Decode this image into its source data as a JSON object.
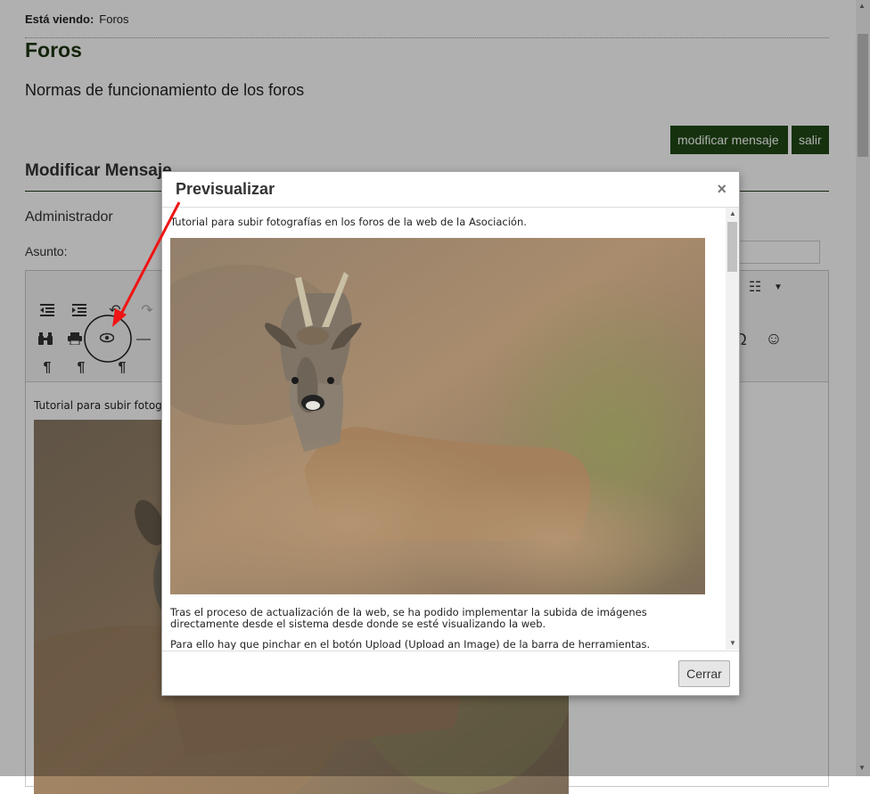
{
  "breadcrumb": {
    "label": "Está viendo:",
    "current": "Foros"
  },
  "page": {
    "title": "Foros",
    "forum_description": "Normas de funcionamiento de los foros",
    "buttons": {
      "modify": "modificar mensaje",
      "exit": "salir"
    },
    "section_title": "Modificar Mensaje",
    "author": "Administrador",
    "subject_label": "Asunto:"
  },
  "editor": {
    "text": "Tutorial para subir fotografías en los foros de la web de la Asociación.",
    "toolbar_icons": [
      "outdent-icon",
      "indent-icon",
      "undo-icon",
      "redo-icon",
      "find-icon",
      "print-icon",
      "preview-icon",
      "horizontal-rule-icon",
      "ltr-icon",
      "rtl-icon",
      "paragraph-icon",
      "numbered-list-icon",
      "special-char-icon",
      "emoticon-icon"
    ]
  },
  "modal": {
    "title": "Previsualizar",
    "close_symbol": "×",
    "intro": "Tutorial para subir fotografías en los foros de la web de la Asociación.",
    "paragraph1": "Tras el proceso de actualización de la web, se ha podido implementar la subida de imágenes directamente desde el sistema desde donde se esté visualizando la web.",
    "paragraph2": "Para ello hay que pinchar en el botón Upload (Upload an Image) de la barra de herramientas.",
    "close_button": "Cerrar"
  },
  "colors": {
    "brand_green": "#1f4714",
    "title_green": "#1d3512",
    "annotation_red": "#f01414"
  }
}
